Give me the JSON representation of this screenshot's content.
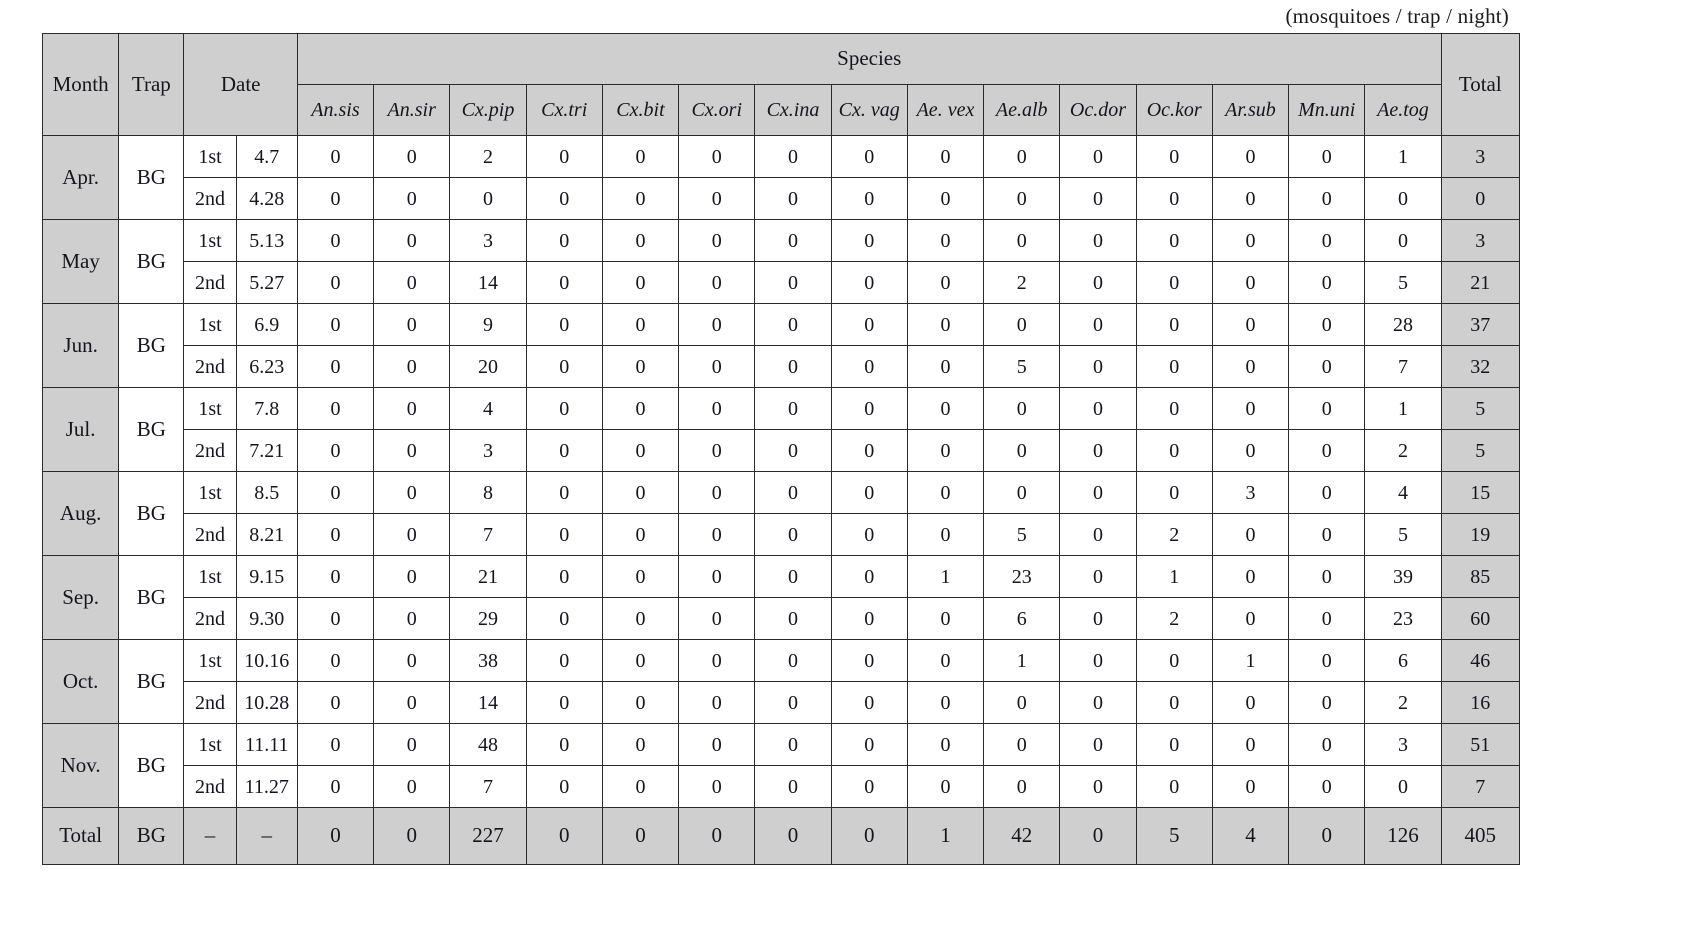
{
  "unit_note": "(mosquitoes / trap / night)",
  "header": {
    "month": "Month",
    "trap": "Trap",
    "date": "Date",
    "species_group": "Species",
    "total": "Total",
    "species": [
      "An.sis",
      "An.sir",
      "Cx.pip",
      "Cx.tri",
      "Cx.bit",
      "Cx.ori",
      "Cx.ina",
      "Cx. vag",
      "Ae. vex",
      "Ae.alb",
      "Oc.dor",
      "Oc.kor",
      "Ar.sub",
      "Mn.uni",
      "Ae.tog"
    ]
  },
  "rows": [
    {
      "month": "Apr.",
      "trap": "BG",
      "ord": "1st",
      "date": "4.7",
      "values": [
        0,
        0,
        2,
        0,
        0,
        0,
        0,
        0,
        0,
        0,
        0,
        0,
        0,
        0,
        1
      ],
      "total": 3,
      "month_span": 2
    },
    {
      "month": "",
      "trap": "",
      "ord": "2nd",
      "date": "4.28",
      "values": [
        0,
        0,
        0,
        0,
        0,
        0,
        0,
        0,
        0,
        0,
        0,
        0,
        0,
        0,
        0
      ],
      "total": 0,
      "month_span": 0
    },
    {
      "month": "May",
      "trap": "BG",
      "ord": "1st",
      "date": "5.13",
      "values": [
        0,
        0,
        3,
        0,
        0,
        0,
        0,
        0,
        0,
        0,
        0,
        0,
        0,
        0,
        0
      ],
      "total": 3,
      "month_span": 2
    },
    {
      "month": "",
      "trap": "",
      "ord": "2nd",
      "date": "5.27",
      "values": [
        0,
        0,
        14,
        0,
        0,
        0,
        0,
        0,
        0,
        2,
        0,
        0,
        0,
        0,
        5
      ],
      "total": 21,
      "month_span": 0
    },
    {
      "month": "Jun.",
      "trap": "BG",
      "ord": "1st",
      "date": "6.9",
      "values": [
        0,
        0,
        9,
        0,
        0,
        0,
        0,
        0,
        0,
        0,
        0,
        0,
        0,
        0,
        28
      ],
      "total": 37,
      "month_span": 2
    },
    {
      "month": "",
      "trap": "",
      "ord": "2nd",
      "date": "6.23",
      "values": [
        0,
        0,
        20,
        0,
        0,
        0,
        0,
        0,
        0,
        5,
        0,
        0,
        0,
        0,
        7
      ],
      "total": 32,
      "month_span": 0
    },
    {
      "month": "Jul.",
      "trap": "BG",
      "ord": "1st",
      "date": "7.8",
      "values": [
        0,
        0,
        4,
        0,
        0,
        0,
        0,
        0,
        0,
        0,
        0,
        0,
        0,
        0,
        1
      ],
      "total": 5,
      "month_span": 2
    },
    {
      "month": "",
      "trap": "",
      "ord": "2nd",
      "date": "7.21",
      "values": [
        0,
        0,
        3,
        0,
        0,
        0,
        0,
        0,
        0,
        0,
        0,
        0,
        0,
        0,
        2
      ],
      "total": 5,
      "month_span": 0
    },
    {
      "month": "Aug.",
      "trap": "BG",
      "ord": "1st",
      "date": "8.5",
      "values": [
        0,
        0,
        8,
        0,
        0,
        0,
        0,
        0,
        0,
        0,
        0,
        0,
        3,
        0,
        4
      ],
      "total": 15,
      "month_span": 2
    },
    {
      "month": "",
      "trap": "",
      "ord": "2nd",
      "date": "8.21",
      "values": [
        0,
        0,
        7,
        0,
        0,
        0,
        0,
        0,
        0,
        5,
        0,
        2,
        0,
        0,
        5
      ],
      "total": 19,
      "month_span": 0
    },
    {
      "month": "Sep.",
      "trap": "BG",
      "ord": "1st",
      "date": "9.15",
      "values": [
        0,
        0,
        21,
        0,
        0,
        0,
        0,
        0,
        1,
        23,
        0,
        1,
        0,
        0,
        39
      ],
      "total": 85,
      "month_span": 2
    },
    {
      "month": "",
      "trap": "",
      "ord": "2nd",
      "date": "9.30",
      "values": [
        0,
        0,
        29,
        0,
        0,
        0,
        0,
        0,
        0,
        6,
        0,
        2,
        0,
        0,
        23
      ],
      "total": 60,
      "month_span": 0
    },
    {
      "month": "Oct.",
      "trap": "BG",
      "ord": "1st",
      "date": "10.16",
      "values": [
        0,
        0,
        38,
        0,
        0,
        0,
        0,
        0,
        0,
        1,
        0,
        0,
        1,
        0,
        6
      ],
      "total": 46,
      "month_span": 2
    },
    {
      "month": "",
      "trap": "",
      "ord": "2nd",
      "date": "10.28",
      "values": [
        0,
        0,
        14,
        0,
        0,
        0,
        0,
        0,
        0,
        0,
        0,
        0,
        0,
        0,
        2
      ],
      "total": 16,
      "month_span": 0
    },
    {
      "month": "Nov.",
      "trap": "BG",
      "ord": "1st",
      "date": "11.11",
      "values": [
        0,
        0,
        48,
        0,
        0,
        0,
        0,
        0,
        0,
        0,
        0,
        0,
        0,
        0,
        3
      ],
      "total": 51,
      "month_span": 2
    },
    {
      "month": "",
      "trap": "",
      "ord": "2nd",
      "date": "11.27",
      "values": [
        0,
        0,
        7,
        0,
        0,
        0,
        0,
        0,
        0,
        0,
        0,
        0,
        0,
        0,
        0
      ],
      "total": 7,
      "month_span": 0
    }
  ],
  "grand_total": {
    "month": "Total",
    "trap": "BG",
    "ord": "–",
    "date": "–",
    "values": [
      0,
      0,
      227,
      0,
      0,
      0,
      0,
      0,
      1,
      42,
      0,
      5,
      4,
      0,
      126
    ],
    "total": 405
  }
}
